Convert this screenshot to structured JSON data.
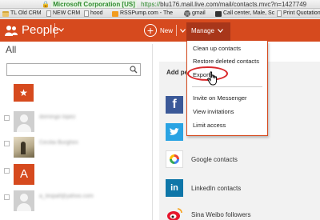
{
  "browser": {
    "cert_label": "Microsoft Corporation [US]",
    "url_scheme": "https://",
    "url_rest": "blu176.mail.live.com/mail/contacts.mvc?n=1427749",
    "bookmarks": [
      {
        "label": "TL Old CRM",
        "icon": "folder-icon"
      },
      {
        "label": "NEW CRM",
        "icon": "page-icon"
      },
      {
        "label": "hood",
        "icon": "page-icon"
      },
      {
        "label": "RSSPump.com - The",
        "icon": "rss-icon"
      },
      {
        "label": "gmail",
        "icon": "gear-icon"
      },
      {
        "label": "Call center, Male, Sc",
        "icon": "phone-icon"
      },
      {
        "label": "Print Quotation",
        "icon": "page-icon"
      }
    ]
  },
  "appbar": {
    "title": "People",
    "new_label": "New",
    "manage_label": "Manage",
    "accent_color": "#d64a1e"
  },
  "left": {
    "heading": "All",
    "search_placeholder": "",
    "favorites_glyph": "★",
    "contacts": [
      {
        "name": "domingo lopez",
        "avatar": "generic"
      },
      {
        "name": "Cecilia Burghini",
        "avatar": "photo"
      },
      {
        "name": "",
        "avatar": "letter",
        "letter": "A"
      },
      {
        "name": "a_lespaf@yahoo.com",
        "avatar": "generic"
      }
    ]
  },
  "right": {
    "heading": "Add pe",
    "services": [
      {
        "label": "",
        "logo": "f",
        "icon": "facebook-icon"
      },
      {
        "label": "",
        "logo": "t",
        "icon": "twitter-icon"
      },
      {
        "label": "Google contacts",
        "logo": "",
        "icon": "google-icon"
      },
      {
        "label": "LinkedIn contacts",
        "logo": "in",
        "icon": "linkedin-icon"
      },
      {
        "label": "Sina Weibo followers",
        "logo": "",
        "icon": "sina-weibo-icon"
      }
    ]
  },
  "manage_menu": {
    "items": [
      "Clean up contacts",
      "Restore deleted contacts",
      "Export",
      "Invite on Messenger",
      "View invitations",
      "Limit access"
    ],
    "highlight_color": "#d9292b"
  }
}
